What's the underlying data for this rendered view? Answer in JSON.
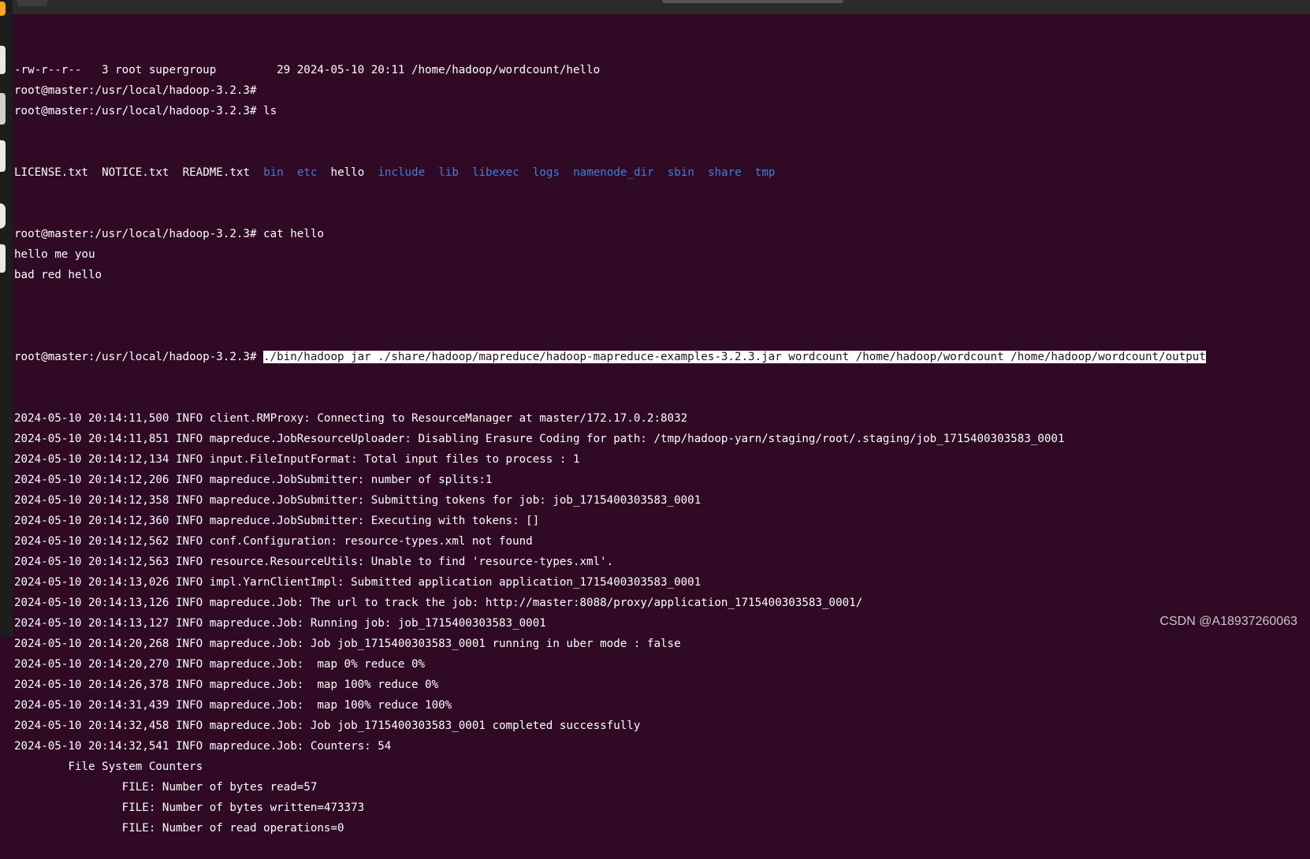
{
  "terminal": {
    "pre_lines": [
      "-rw-r--r--   3 root supergroup         29 2024-05-10 20:11 /home/hadoop/wordcount/hello",
      "root@master:/usr/local/hadoop-3.2.3#",
      "root@master:/usr/local/hadoop-3.2.3# ls"
    ],
    "ls_listing": [
      {
        "name": "LICENSE.txt",
        "type": "file"
      },
      {
        "name": "NOTICE.txt",
        "type": "file"
      },
      {
        "name": "README.txt",
        "type": "file"
      },
      {
        "name": "bin",
        "type": "dir"
      },
      {
        "name": "etc",
        "type": "dir"
      },
      {
        "name": "hello",
        "type": "file"
      },
      {
        "name": "include",
        "type": "dir"
      },
      {
        "name": "lib",
        "type": "dir"
      },
      {
        "name": "libexec",
        "type": "dir"
      },
      {
        "name": "logs",
        "type": "dir"
      },
      {
        "name": "namenode_dir",
        "type": "dir"
      },
      {
        "name": "sbin",
        "type": "dir"
      },
      {
        "name": "share",
        "type": "dir"
      },
      {
        "name": "tmp",
        "type": "dir"
      }
    ],
    "mid_lines": [
      "root@master:/usr/local/hadoop-3.2.3# cat hello",
      "hello me you",
      "bad red hello",
      ""
    ],
    "command_line": {
      "prompt": "root@master:/usr/local/hadoop-3.2.3# ",
      "command": "./bin/hadoop jar ./share/hadoop/mapreduce/hadoop-mapreduce-examples-3.2.3.jar wordcount /home/hadoop/wordcount /home/hadoop/wordcount/output"
    },
    "log_lines": [
      "2024-05-10 20:14:11,500 INFO client.RMProxy: Connecting to ResourceManager at master/172.17.0.2:8032",
      "2024-05-10 20:14:11,851 INFO mapreduce.JobResourceUploader: Disabling Erasure Coding for path: /tmp/hadoop-yarn/staging/root/.staging/job_1715400303583_0001",
      "2024-05-10 20:14:12,134 INFO input.FileInputFormat: Total input files to process : 1",
      "2024-05-10 20:14:12,206 INFO mapreduce.JobSubmitter: number of splits:1",
      "2024-05-10 20:14:12,358 INFO mapreduce.JobSubmitter: Submitting tokens for job: job_1715400303583_0001",
      "2024-05-10 20:14:12,360 INFO mapreduce.JobSubmitter: Executing with tokens: []",
      "2024-05-10 20:14:12,562 INFO conf.Configuration: resource-types.xml not found",
      "2024-05-10 20:14:12,563 INFO resource.ResourceUtils: Unable to find 'resource-types.xml'.",
      "2024-05-10 20:14:13,026 INFO impl.YarnClientImpl: Submitted application application_1715400303583_0001",
      "2024-05-10 20:14:13,126 INFO mapreduce.Job: The url to track the job: http://master:8088/proxy/application_1715400303583_0001/",
      "2024-05-10 20:14:13,127 INFO mapreduce.Job: Running job: job_1715400303583_0001",
      "2024-05-10 20:14:20,268 INFO mapreduce.Job: Job job_1715400303583_0001 running in uber mode : false",
      "2024-05-10 20:14:20,270 INFO mapreduce.Job:  map 0% reduce 0%",
      "2024-05-10 20:14:26,378 INFO mapreduce.Job:  map 100% reduce 0%",
      "2024-05-10 20:14:31,439 INFO mapreduce.Job:  map 100% reduce 100%",
      "2024-05-10 20:14:32,458 INFO mapreduce.Job: Job job_1715400303583_0001 completed successfully",
      "2024-05-10 20:14:32,541 INFO mapreduce.Job: Counters: 54",
      "        File System Counters",
      "                FILE: Number of bytes read=57",
      "                FILE: Number of bytes written=473373",
      "                FILE: Number of read operations=0"
    ]
  },
  "watermark": "CSDN @A18937260063",
  "colors": {
    "background": "#300a24",
    "text": "#ffffff",
    "directory": "#3f7fd6",
    "selection_bg": "#ffffff"
  }
}
